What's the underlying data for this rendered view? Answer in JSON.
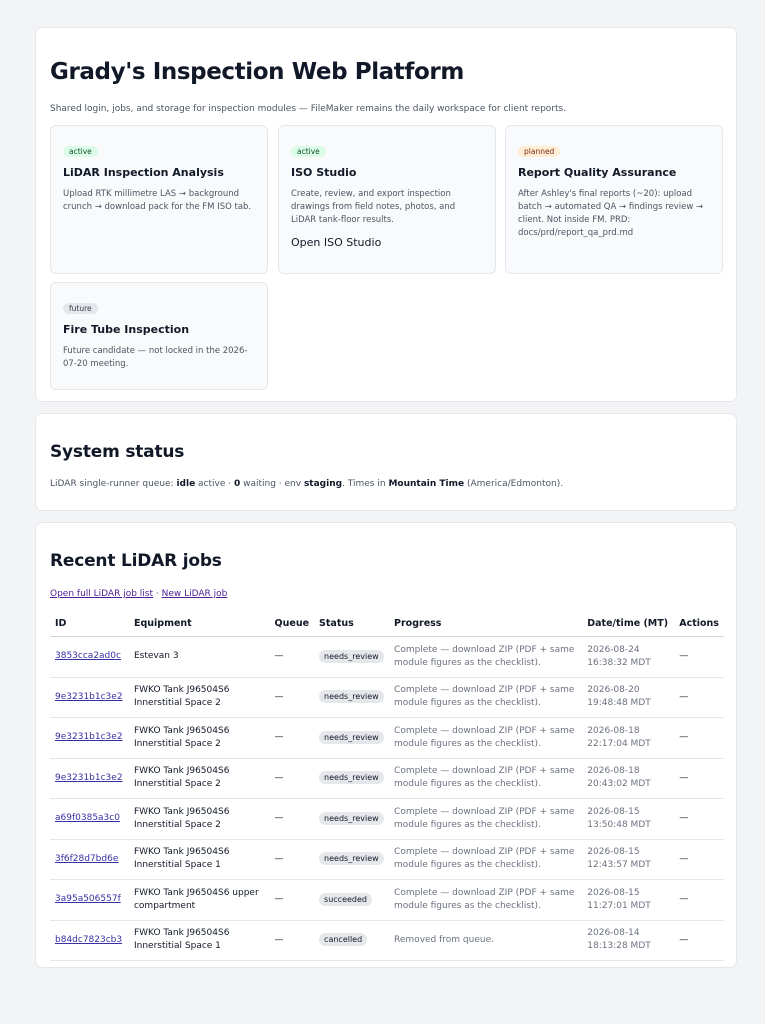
{
  "header": {
    "title": "Grady's Inspection Web Platform",
    "subtitle": "Shared login, jobs, and storage for inspection modules — FileMaker remains the daily workspace for client reports."
  },
  "modules": [
    {
      "badge": "active",
      "title": "LiDAR Inspection Analysis",
      "desc": "Upload RTK millimetre LAS → background crunch → download pack for the FM ISO tab."
    },
    {
      "badge": "active",
      "title": "ISO Studio",
      "desc": "Create, review, and export inspection drawings from field notes, photos, and LiDAR tank-floor results.",
      "link": "Open ISO Studio"
    },
    {
      "badge": "planned",
      "title": "Report Quality Assurance",
      "desc": "After Ashley's final reports (~20): upload batch → automated QA → findings review → client. Not inside FM. PRD: docs/prd/report_qa_prd.md"
    },
    {
      "badge": "future",
      "title": "Fire Tube Inspection",
      "desc": "Future candidate — not locked in the 2026-07-20 meeting."
    }
  ],
  "status": {
    "title": "System status",
    "t1": "LiDAR single-runner queue: ",
    "state": "idle",
    "t2": " active · ",
    "waiting": "0",
    "t3": " waiting · env ",
    "env": "staging",
    "t4": ". Times in ",
    "tz": "Mountain Time",
    "t5": " (America/Edmonton)."
  },
  "jobs": {
    "title": "Recent LiDAR jobs",
    "link_full": "Open full LiDAR job list",
    "sep": " · ",
    "link_new": "New LiDAR job",
    "columns": [
      "ID",
      "Equipment",
      "Queue",
      "Status",
      "Progress",
      "Date/time (MT)",
      "Actions"
    ],
    "rows": [
      {
        "id": "3853cca2ad0c",
        "equipment": "Estevan 3",
        "queue": "—",
        "status": "needs_review",
        "progress": "Complete — download ZIP (PDF + same module figures as the checklist).",
        "datetime": "2026-08-24 16:38:32 MDT",
        "actions": "—"
      },
      {
        "id": "9e3231b1c3e2",
        "equipment": "FWKO Tank J96504S6 Innerstitial Space 2",
        "queue": "—",
        "status": "needs_review",
        "progress": "Complete — download ZIP (PDF + same module figures as the checklist).",
        "datetime": "2026-08-20 19:48:48 MDT",
        "actions": "—"
      },
      {
        "id": "9e3231b1c3e2",
        "equipment": "FWKO Tank J96504S6 Innerstitial Space 2",
        "queue": "—",
        "status": "needs_review",
        "progress": "Complete — download ZIP (PDF + same module figures as the checklist).",
        "datetime": "2026-08-18 22:17:04 MDT",
        "actions": "—"
      },
      {
        "id": "9e3231b1c3e2",
        "equipment": "FWKO Tank J96504S6 Innerstitial Space 2",
        "queue": "—",
        "status": "needs_review",
        "progress": "Complete — download ZIP (PDF + same module figures as the checklist).",
        "datetime": "2026-08-18 20:43:02 MDT",
        "actions": "—"
      },
      {
        "id": "a69f0385a3c0",
        "equipment": "FWKO Tank J96504S6 Innerstitial Space 2",
        "queue": "—",
        "status": "needs_review",
        "progress": "Complete — download ZIP (PDF + same module figures as the checklist).",
        "datetime": "2026-08-15 13:50:48 MDT",
        "actions": "—"
      },
      {
        "id": "3f6f28d7bd6e",
        "equipment": "FWKO Tank J96504S6 Innerstitial Space 1",
        "queue": "—",
        "status": "needs_review",
        "progress": "Complete — download ZIP (PDF + same module figures as the checklist).",
        "datetime": "2026-08-15 12:43:57 MDT",
        "actions": "—"
      },
      {
        "id": "3a95a506557f",
        "equipment": "FWKO Tank J96504S6 upper compartment",
        "queue": "—",
        "status": "succeeded",
        "progress": "Complete — download ZIP (PDF + same module figures as the checklist).",
        "datetime": "2026-08-15 11:27:01 MDT",
        "actions": "—"
      },
      {
        "id": "b84dc7823cb3",
        "equipment": "FWKO Tank J96504S6 Innerstitial Space 1",
        "queue": "—",
        "status": "cancelled",
        "progress": "Removed from queue.",
        "datetime": "2026-08-14 18:13:28 MDT",
        "actions": "—"
      }
    ]
  }
}
